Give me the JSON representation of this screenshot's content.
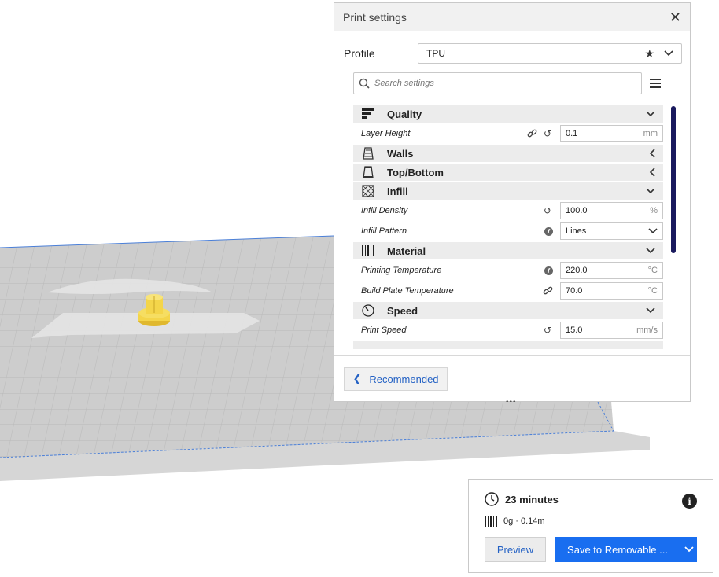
{
  "window": {
    "title": "Print settings"
  },
  "profile": {
    "label": "Profile",
    "value": "TPU"
  },
  "search": {
    "placeholder": "Search settings"
  },
  "categories": {
    "quality": {
      "label": "Quality"
    },
    "walls": {
      "label": "Walls"
    },
    "top_bottom": {
      "label": "Top/Bottom"
    },
    "infill": {
      "label": "Infill"
    },
    "material": {
      "label": "Material"
    },
    "speed": {
      "label": "Speed"
    }
  },
  "settings": {
    "layer_height": {
      "label": "Layer Height",
      "value": "0.1",
      "unit": "mm"
    },
    "infill_density": {
      "label": "Infill Density",
      "value": "100.0",
      "unit": "%"
    },
    "infill_pattern": {
      "label": "Infill Pattern",
      "value": "Lines"
    },
    "printing_temperature": {
      "label": "Printing Temperature",
      "value": "220.0",
      "unit": "°C"
    },
    "build_plate_temperature": {
      "label": "Build Plate Temperature",
      "value": "70.0",
      "unit": "°C"
    },
    "print_speed": {
      "label": "Print Speed",
      "value": "15.0",
      "unit": "mm/s"
    }
  },
  "footer": {
    "recommended_label": "Recommended"
  },
  "action": {
    "print_time": "23 minutes",
    "material_usage": "0g · 0.14m",
    "preview_label": "Preview",
    "save_label": "Save to Removable ..."
  },
  "colors": {
    "accent": "#196ef0",
    "link": "#2361c4",
    "model": "#f4d54a",
    "scrollbar": "#1a1a5e"
  }
}
